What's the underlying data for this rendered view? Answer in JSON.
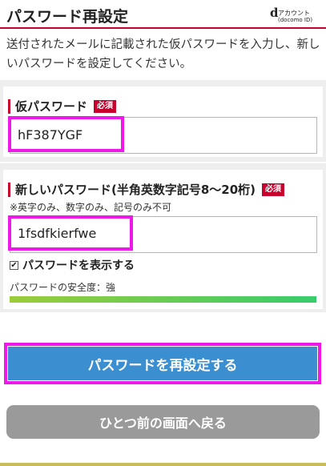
{
  "header": {
    "title": "パスワード再設定",
    "logo_letter": "d",
    "logo_line1": "アカウント",
    "logo_line2": "(docomo ID)"
  },
  "intro": "送付されたメールに記載された仮パスワードを入力し、新しいパスワードを設定してください。",
  "temp_password": {
    "label": "仮パスワード",
    "required_badge": "必須",
    "value": "hF387YGF"
  },
  "new_password": {
    "label": "新しいパスワード(半角英数字記号8～20桁)",
    "required_badge": "必須",
    "note": "※英字のみ、数字のみ、記号のみ不可",
    "value": "1fsdfkierfwe"
  },
  "show_password": {
    "checked": true,
    "check_mark": "✔",
    "label": "パスワードを表示する"
  },
  "strength": {
    "label": "パスワードの安全度：強",
    "level": 1.0
  },
  "buttons": {
    "submit": "パスワードを再設定する",
    "back": "ひとつ前の画面へ戻る"
  }
}
